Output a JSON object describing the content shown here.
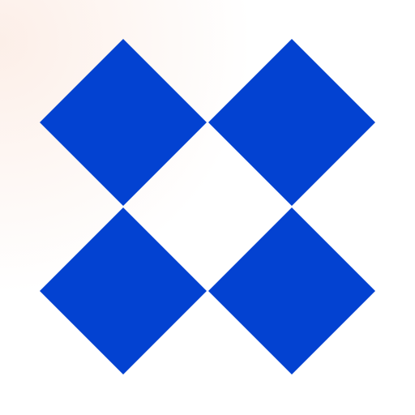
{
  "logo": {
    "icon": "four-diamond-x-logo",
    "color": "#0342d1",
    "background": "#ffffff",
    "background_tint": "#fcece4"
  }
}
